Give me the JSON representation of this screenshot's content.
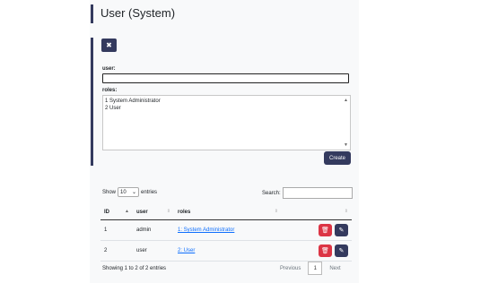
{
  "page": {
    "title": "User (System)"
  },
  "form": {
    "close_label": "✖",
    "user_label": "user:",
    "user_value": "",
    "roles_label": "roles:",
    "roles_options": [
      "1 System Administrator",
      "2 User"
    ],
    "create_label": "Create"
  },
  "table_controls": {
    "show_label": "Show",
    "entries_value": "10",
    "entries_label": "entries",
    "search_label": "Search:"
  },
  "table": {
    "headers": [
      "ID",
      "user",
      "roles"
    ],
    "rows": [
      {
        "id": "1",
        "user": "admin",
        "roles": "1: System Administrator"
      },
      {
        "id": "2",
        "user": "user",
        "roles": "2: User"
      }
    ]
  },
  "footer": {
    "info": "Showing 1 to 2 of 2 entries",
    "previous": "Previous",
    "current_page": "1",
    "next": "Next"
  },
  "colors": {
    "primary": "#343a5e",
    "danger": "#dc3545",
    "link": "#0d6efd"
  }
}
